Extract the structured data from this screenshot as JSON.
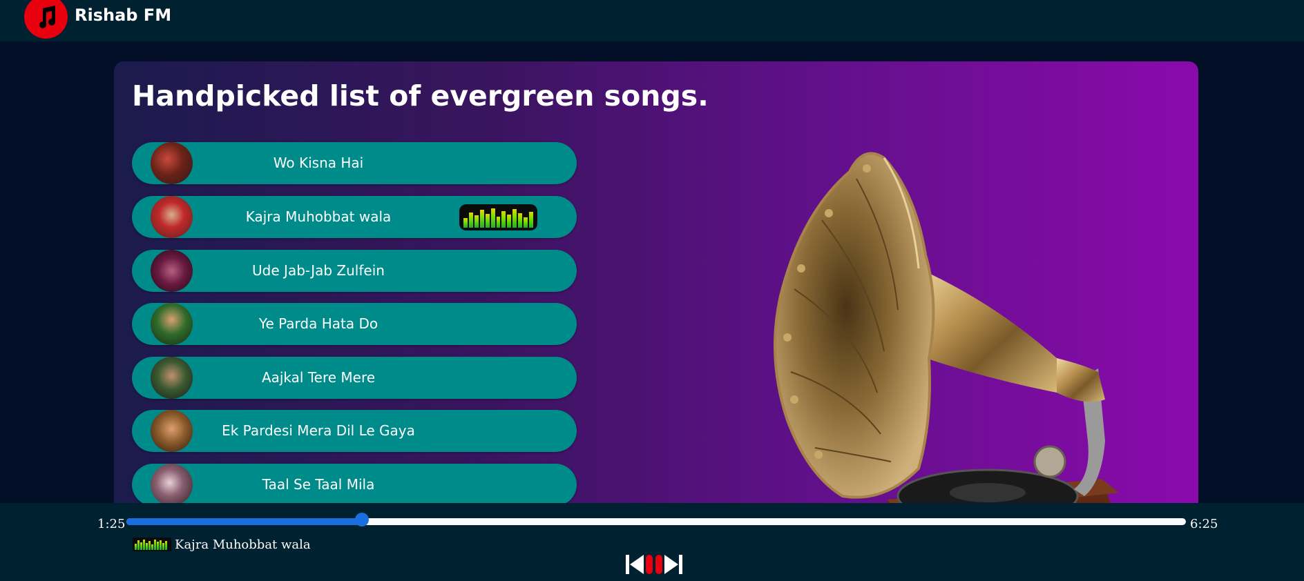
{
  "header": {
    "brand": "Rishab FM",
    "logo_icon": "music-note-icon",
    "logo_color": "#e8000f"
  },
  "main": {
    "title": "Handpicked list of evergreen songs.",
    "songs": [
      {
        "name": "Wo Kisna Hai",
        "playing": false
      },
      {
        "name": "Kajra Muhobbat wala",
        "playing": true
      },
      {
        "name": "Ude Jab-Jab Zulfein",
        "playing": false
      },
      {
        "name": "Ye Parda Hata Do",
        "playing": false
      },
      {
        "name": "Aajkal Tere Mere",
        "playing": false
      },
      {
        "name": "Ek Pardesi Mera Dil Le Gaya",
        "playing": false
      },
      {
        "name": "Taal Se Taal Mila",
        "playing": false
      }
    ],
    "song_item_color": "#008b8b"
  },
  "player": {
    "current_time": "1:25",
    "total_time": "6:25",
    "progress": 0.222,
    "now_playing": "Kajra Muhobbat wala",
    "accent": "#1a6fe0",
    "controls": [
      "previous-icon",
      "pause-icon",
      "next-icon"
    ]
  }
}
